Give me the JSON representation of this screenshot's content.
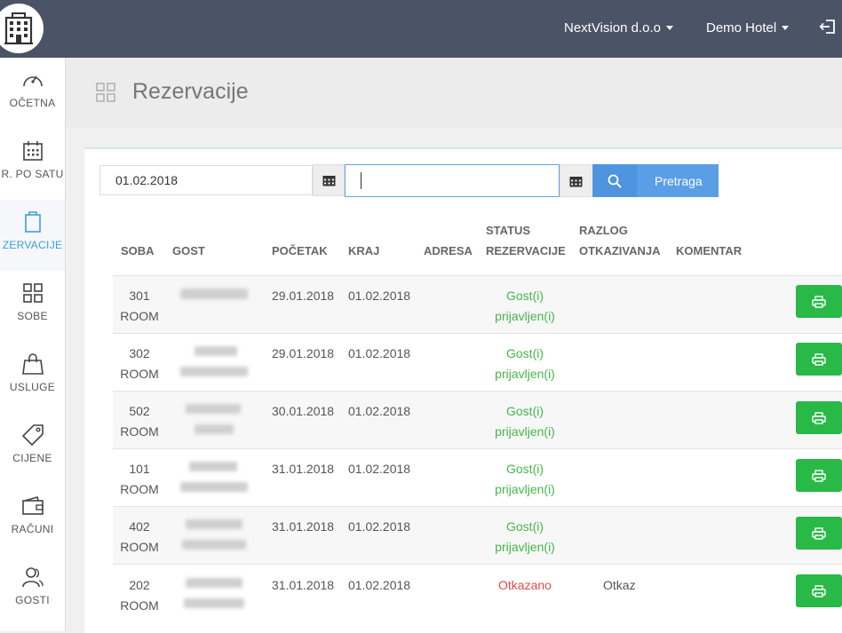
{
  "topbar": {
    "company": "NextVision d.o.o",
    "hotel": "Demo Hotel"
  },
  "sidebar": {
    "items": [
      {
        "label": "OČETNA",
        "icon": "dashboard-icon"
      },
      {
        "label": "R. PO SATU",
        "icon": "calendar-grid-icon"
      },
      {
        "label": "ZERVACIJE",
        "icon": "clipboard-icon"
      },
      {
        "label": "SOBE",
        "icon": "grid-icon"
      },
      {
        "label": "USLUGE",
        "icon": "shopping-bag-icon"
      },
      {
        "label": "CIJENE",
        "icon": "tag-icon"
      },
      {
        "label": "RAČUNI",
        "icon": "wallet-icon"
      },
      {
        "label": "GOSTI",
        "icon": "users-icon"
      }
    ]
  },
  "page": {
    "title": "Rezervacije"
  },
  "search": {
    "date_from": "01.02.2018",
    "date_to": "",
    "button_label": "Pretraga"
  },
  "table": {
    "headers": {
      "soba": "SOBA",
      "gost": "GOST",
      "pocetak": "POČETAK",
      "kraj": "KRAJ",
      "adresa": "ADRESA",
      "status_1": "STATUS",
      "status_2": "REZERVACIJE",
      "razlog_1": "RAZLOG",
      "razlog_2": "OTKAZIVANJA",
      "komentar": "KOMENTAR"
    },
    "rows": [
      {
        "room": "301",
        "room_type": "ROOM",
        "start": "29.01.2018",
        "end": "01.02.2018",
        "status_1": "Gost(i)",
        "status_2": "prijavljen(i)",
        "reason": "",
        "cancelled": false
      },
      {
        "room": "302",
        "room_type": "ROOM",
        "start": "29.01.2018",
        "end": "01.02.2018",
        "status_1": "Gost(i)",
        "status_2": "prijavljen(i)",
        "reason": "",
        "cancelled": false
      },
      {
        "room": "502",
        "room_type": "ROOM",
        "start": "30.01.2018",
        "end": "01.02.2018",
        "status_1": "Gost(i)",
        "status_2": "prijavljen(i)",
        "reason": "",
        "cancelled": false
      },
      {
        "room": "101",
        "room_type": "ROOM",
        "start": "31.01.2018",
        "end": "01.02.2018",
        "status_1": "Gost(i)",
        "status_2": "prijavljen(i)",
        "reason": "",
        "cancelled": false
      },
      {
        "room": "402",
        "room_type": "ROOM",
        "start": "31.01.2018",
        "end": "01.02.2018",
        "status_1": "Gost(i)",
        "status_2": "prijavljen(i)",
        "reason": "",
        "cancelled": false
      },
      {
        "room": "202",
        "room_type": "ROOM",
        "start": "31.01.2018",
        "end": "01.02.2018",
        "status_1": "Otkazano",
        "status_2": "",
        "reason": "Otkaz",
        "cancelled": true
      }
    ]
  },
  "colors": {
    "topbar": "#4a5466",
    "accent": "#3aa0d8",
    "search_button": "#5a9ee6",
    "print_button": "#28b946",
    "status_ok": "#45b649",
    "status_cancel": "#e04b4b"
  }
}
